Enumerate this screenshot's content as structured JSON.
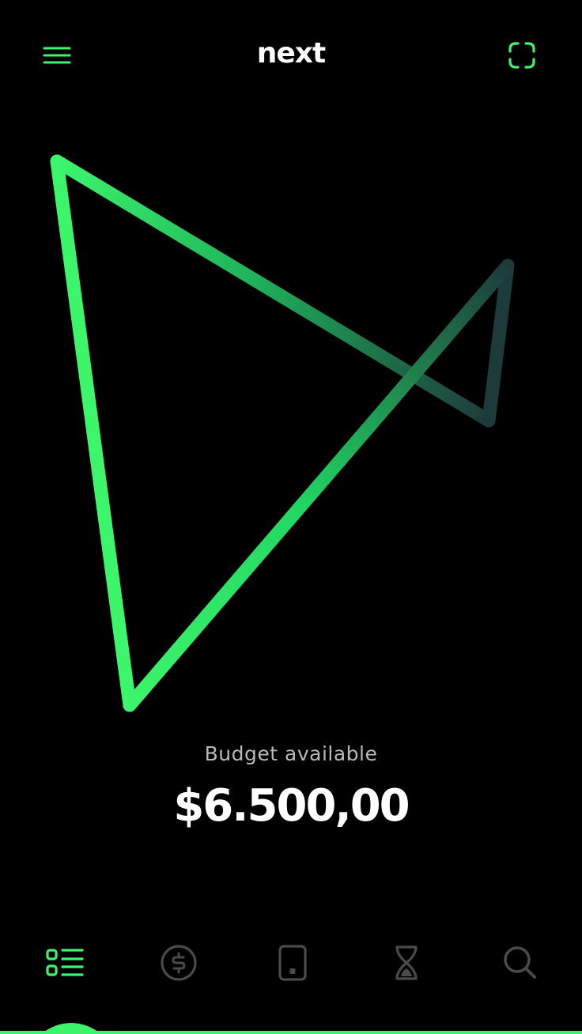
{
  "app": {
    "brand": "next"
  },
  "header": {
    "menu_icon": "hamburger-menu-icon",
    "scan_icon": "scan-frame-icon"
  },
  "budget": {
    "label": "Budget available",
    "amount": "$6.500,00"
  },
  "bottom_nav": {
    "items": [
      {
        "icon": "list-icon",
        "active": true
      },
      {
        "icon": "dollar-circle-icon",
        "active": false
      },
      {
        "icon": "phone-card-icon",
        "active": false
      },
      {
        "icon": "hourglass-icon",
        "active": false
      },
      {
        "icon": "search-icon",
        "active": false
      }
    ]
  },
  "colors": {
    "background": "#000000",
    "accent": "#3cf56b",
    "accent_dark": "#1e3b3b",
    "text_primary": "#ffffff",
    "text_secondary": "#b9b9b9",
    "icon_inactive": "#4a4a4a"
  }
}
